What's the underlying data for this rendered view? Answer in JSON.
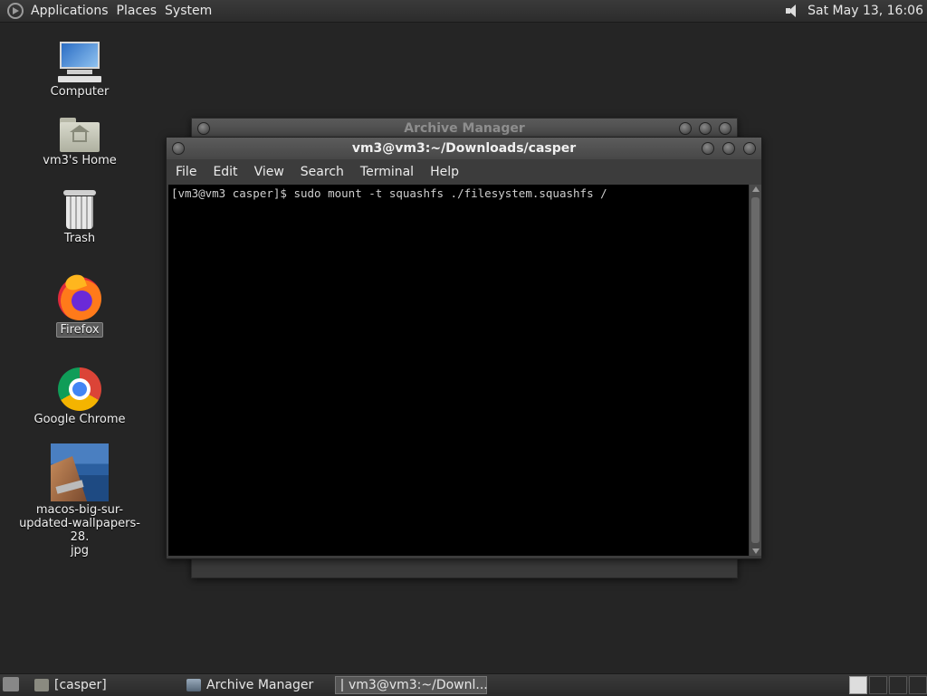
{
  "top_panel": {
    "menus": [
      "Applications",
      "Places",
      "System"
    ],
    "clock": "Sat May 13, 16:06",
    "icons": {
      "logo": "mint-logo-icon",
      "volume": "volume-icon"
    }
  },
  "desktop": {
    "icons": [
      {
        "label": "Computer",
        "icon": "computer-icon"
      },
      {
        "label": "vm3's Home",
        "icon": "home-folder-icon"
      },
      {
        "label": "Trash",
        "icon": "trash-icon"
      },
      {
        "label": "Firefox",
        "icon": "firefox-icon",
        "selected": true
      },
      {
        "label": "Google Chrome",
        "icon": "chrome-icon"
      },
      {
        "label": "macos-big-sur-updated-wallpapers-28.jpg",
        "label_lines": [
          "macos-big-sur-",
          "updated-wallpapers-28.",
          "jpg"
        ],
        "icon": "image-file-icon"
      }
    ]
  },
  "windows": {
    "archive_manager": {
      "title": "Archive Manager"
    },
    "terminal": {
      "title": "vm3@vm3:~/Downloads/casper",
      "menu": [
        "File",
        "Edit",
        "View",
        "Search",
        "Terminal",
        "Help"
      ],
      "content": "[vm3@vm3 casper]$ sudo mount -t squashfs ./filesystem.squashfs /"
    }
  },
  "bottom_panel": {
    "tasks": [
      {
        "label": "[casper]",
        "icon": "folder-icon"
      },
      {
        "label": "Archive Manager",
        "icon": "archive-manager-icon"
      },
      {
        "label": "vm3@vm3:~/Downl...",
        "icon": "terminal-icon",
        "active": true
      }
    ],
    "workspaces": 4,
    "current_workspace": 1
  }
}
